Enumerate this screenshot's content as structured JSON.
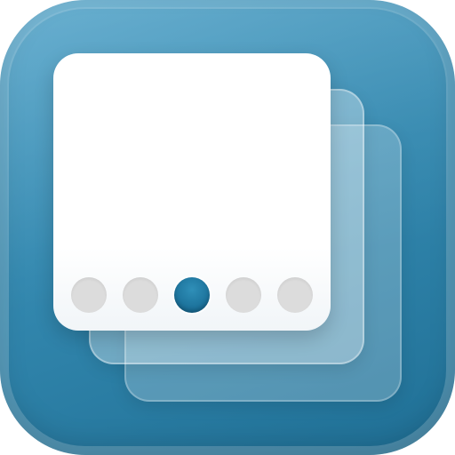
{
  "icon": {
    "name": "page-stack-icon",
    "colors": {
      "background_top": "#5aa8cc",
      "background_bottom": "#1f6f95",
      "card": "#ffffff",
      "dot_inactive": "#dcdcdc",
      "dot_active": "#1a6f98"
    },
    "page_indicator": {
      "total": 5,
      "active_index": 2
    }
  }
}
